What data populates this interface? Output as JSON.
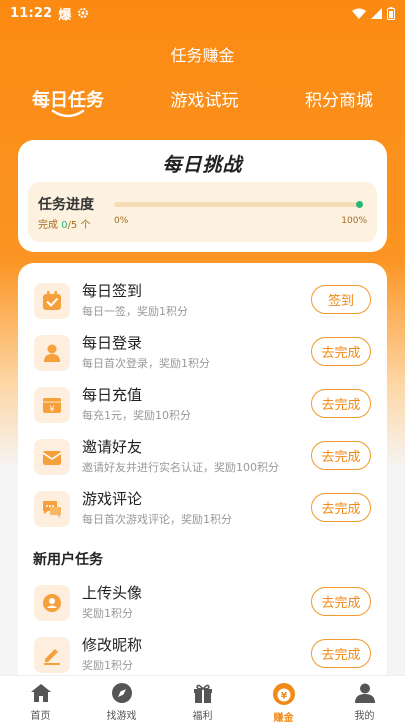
{
  "status_bar": {
    "time": "11:22",
    "app_icon_text": "爆"
  },
  "header": {
    "title": "任务赚金"
  },
  "tabs": [
    {
      "label": "每日任务",
      "active": true
    },
    {
      "label": "游戏试玩",
      "active": false
    },
    {
      "label": "积分商城",
      "active": false
    }
  ],
  "challenge": {
    "title": "每日挑战",
    "progress_label": "任务进度",
    "count_prefix": "完成 ",
    "count_done": "0",
    "count_suffix": "/5 个",
    "progress_fraction": 1.0,
    "start_pct": "0%",
    "end_pct": "100%"
  },
  "daily_tasks": [
    {
      "title": "每日签到",
      "desc": "每日一签，奖励1积分",
      "button": "签到",
      "icon": "calendar-check-icon"
    },
    {
      "title": "每日登录",
      "desc": "每日首次登录，奖励1积分",
      "button": "去完成",
      "icon": "user-icon"
    },
    {
      "title": "每日充值",
      "desc": "每充1元，奖励10积分",
      "button": "去完成",
      "icon": "yen-card-icon"
    },
    {
      "title": "邀请好友",
      "desc": "邀请好友并进行实名认证，奖励100积分",
      "button": "去完成",
      "icon": "envelope-icon"
    },
    {
      "title": "游戏评论",
      "desc": "每日首次游戏评论，奖励1积分",
      "button": "去完成",
      "icon": "comment-icon"
    }
  ],
  "new_user_section": {
    "title": "新用户任务"
  },
  "new_user_tasks": [
    {
      "title": "上传头像",
      "desc": "奖励1积分",
      "button": "去完成",
      "icon": "avatar-icon"
    },
    {
      "title": "修改昵称",
      "desc": "奖励1积分",
      "button": "去完成",
      "icon": "pencil-icon"
    }
  ],
  "bottom_nav": [
    {
      "label": "首页",
      "icon": "home-icon",
      "active": false
    },
    {
      "label": "找游戏",
      "icon": "compass-icon",
      "active": false
    },
    {
      "label": "福利",
      "icon": "gift-icon",
      "active": false
    },
    {
      "label": "赚金",
      "icon": "money-bag-icon",
      "active": true
    },
    {
      "label": "我的",
      "icon": "profile-icon",
      "active": false
    }
  ],
  "colors": {
    "accent": "#f08a18",
    "success": "#2bb673",
    "header_bg": "#fb8a12"
  }
}
